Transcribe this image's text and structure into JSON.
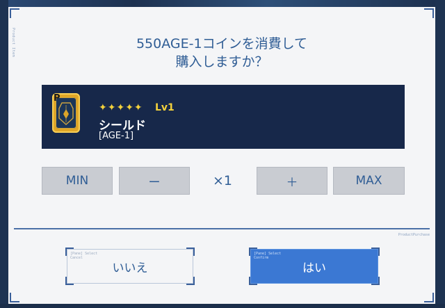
{
  "dialog": {
    "title_line1": "550AGE-1コインを消費して",
    "title_line2": "購入しますか？",
    "side_tag": "Product Item"
  },
  "item": {
    "icon_letter": "P",
    "stars": "✦✦✦✦✦",
    "level": "Lv1",
    "name": "シールド",
    "subtitle": "[AGE-1]"
  },
  "quantity": {
    "min_label": "MIN",
    "minus_label": "ー",
    "value": "×1",
    "plus_label": "＋",
    "max_label": "MAX"
  },
  "divider_tag": "ProductPurchase",
  "actions": {
    "no_label": "いいえ",
    "yes_label": "はい",
    "no_tag": "[Pane] Select\nCancel",
    "yes_tag": "[Pane] Select\nConfirm"
  },
  "colors": {
    "accent": "#2f5d95",
    "panel": "#17284a",
    "primary_button": "#3b78d3",
    "star": "#f4d23c"
  }
}
